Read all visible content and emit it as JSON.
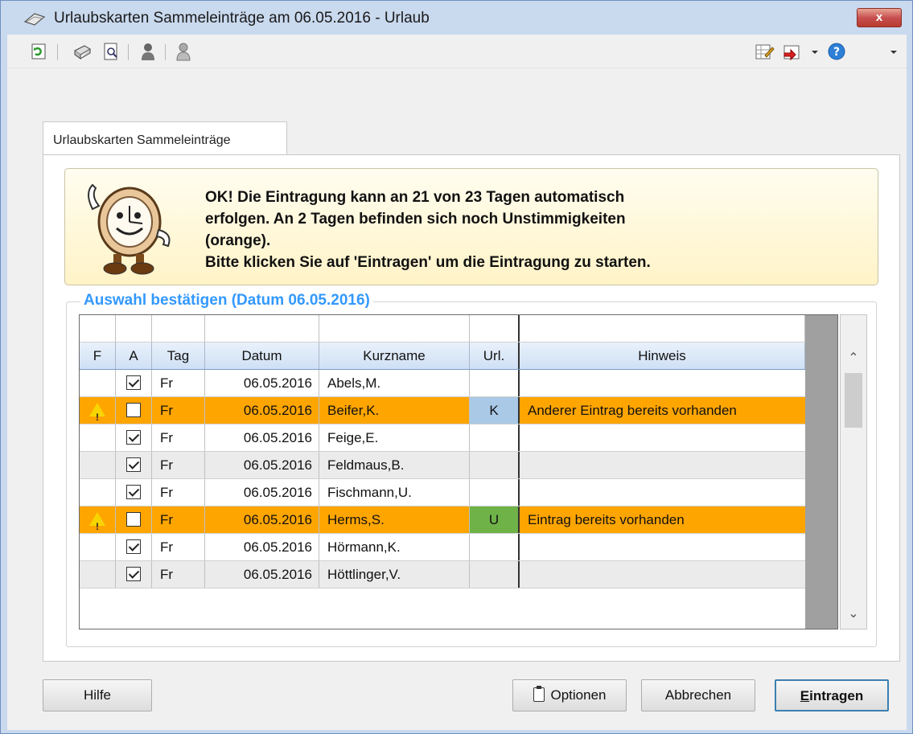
{
  "window": {
    "title": "Urlaubskarten Sammeleinträge am 06.05.2016 - Urlaub",
    "close_label": "x"
  },
  "toolbar": {
    "left_icons": [
      "refresh-icon",
      "print-icon",
      "print-preview-icon",
      "person-icon",
      "person-gray-icon"
    ],
    "right_icons": [
      "edit-table-icon",
      "export-icon",
      "help-icon"
    ]
  },
  "tab": {
    "label": "Urlaubskarten Sammeleinträge"
  },
  "banner": {
    "lines": [
      "OK! Die Eintragung kann an 21 von 23 Tagen automatisch",
      "erfolgen. An 2 Tagen befinden sich noch Unstimmigkeiten",
      "(orange).",
      "Bitte klicken Sie auf 'Eintragen' um die Eintragung zu starten."
    ]
  },
  "group": {
    "title": "Auswahl bestätigen (Datum 06.05.2016)"
  },
  "table": {
    "columns": {
      "f": "F",
      "a": "A",
      "tag": "Tag",
      "datum": "Datum",
      "kurzname": "Kurzname",
      "url": "Url.",
      "hinweis": "Hinweis"
    },
    "rows": [
      {
        "warn": false,
        "checked": true,
        "tag": "Fr",
        "datum": "06.05.2016",
        "kurzname": "Abels,M.",
        "url": "",
        "hinweis": "",
        "style": "white"
      },
      {
        "warn": true,
        "checked": false,
        "tag": "Fr",
        "datum": "06.05.2016",
        "kurzname": "Beifer,K.",
        "url": "K",
        "hinweis": "Anderer Eintrag bereits vorhanden",
        "style": "orange"
      },
      {
        "warn": false,
        "checked": true,
        "tag": "Fr",
        "datum": "06.05.2016",
        "kurzname": "Feige,E.",
        "url": "",
        "hinweis": "",
        "style": "white"
      },
      {
        "warn": false,
        "checked": true,
        "tag": "Fr",
        "datum": "06.05.2016",
        "kurzname": "Feldmaus,B.",
        "url": "",
        "hinweis": "",
        "style": "gray"
      },
      {
        "warn": false,
        "checked": true,
        "tag": "Fr",
        "datum": "06.05.2016",
        "kurzname": "Fischmann,U.",
        "url": "",
        "hinweis": "",
        "style": "white"
      },
      {
        "warn": true,
        "checked": false,
        "tag": "Fr",
        "datum": "06.05.2016",
        "kurzname": "Herms,S.",
        "url": "U",
        "hinweis": "Eintrag bereits vorhanden",
        "style": "orange"
      },
      {
        "warn": false,
        "checked": true,
        "tag": "Fr",
        "datum": "06.05.2016",
        "kurzname": "Hörmann,K.",
        "url": "",
        "hinweis": "",
        "style": "white"
      },
      {
        "warn": false,
        "checked": true,
        "tag": "Fr",
        "datum": "06.05.2016",
        "kurzname": "Höttlinger,V.",
        "url": "",
        "hinweis": "",
        "style": "gray"
      }
    ]
  },
  "buttons": {
    "hilfe": "Hilfe",
    "optionen": "Optionen",
    "abbrechen": "Abbrechen",
    "eintragen_first": "E",
    "eintragen_rest": "intragen"
  },
  "colors": {
    "orange_row": "#ffa500",
    "url_k": "#a9c9e6",
    "url_u": "#6fb247",
    "group_title": "#3399ff"
  }
}
